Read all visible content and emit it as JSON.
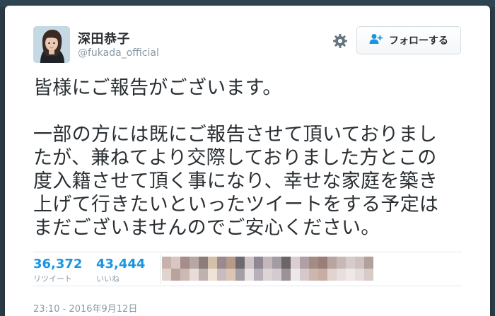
{
  "tweet": {
    "author": {
      "display_name": "深田恭子",
      "screen_name": "@fukada_official"
    },
    "actions": {
      "follow_label": "フォローする"
    },
    "lines": [
      "皆様にご報告がございます。",
      "",
      "一部の方には既にご報告させて頂いておりまし",
      "たが、兼ねてより交際しておりました方とこの",
      "度入籍させて頂く事になり、幸せな家庭を築き",
      "上げて行きたいといったツイートをする予定は",
      "まだございませんのでご安心ください。"
    ],
    "stats": {
      "retweets": {
        "count": "36,372",
        "label": "リツイート"
      },
      "likes": {
        "count": "43,444",
        "label": "いいね"
      }
    },
    "timestamp": "23:10 - 2016年9月12日"
  },
  "icons": {
    "settings": "gear-icon",
    "follow": "add-user-icon"
  },
  "colors": {
    "accent": "#1b95e0",
    "text": "#292f33",
    "muted": "#8899a6",
    "border": "#e1e8ed"
  }
}
